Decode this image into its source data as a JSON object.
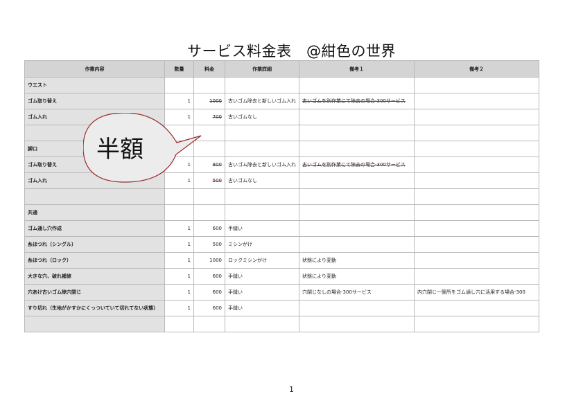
{
  "title": "サービス料金表　@紺色の世界",
  "columns": [
    "作業内容",
    "数量",
    "料金",
    "作業詳細",
    "備考１",
    "備考２"
  ],
  "rows": [
    [
      "ウエスト",
      "",
      "",
      "",
      "",
      ""
    ],
    [
      "ゴム取り替え",
      "1",
      "1000",
      "古いゴム除去と新しいゴム入れ",
      "古いゴムを別作業にて除去の場合-300サービス",
      ""
    ],
    [
      "ゴム入れ",
      "1",
      "700",
      "古いゴムなし",
      "",
      ""
    ],
    [
      "",
      "",
      "",
      "",
      "",
      ""
    ],
    [
      "脚口",
      "",
      "",
      "",
      "",
      ""
    ],
    [
      "ゴム取り替え",
      "1",
      "800",
      "古いゴム除去と新しいゴム入れ",
      "古いゴムを別作業にて除去の場合-300サービス",
      ""
    ],
    [
      "ゴム入れ",
      "1",
      "500",
      "古いゴムなし",
      "",
      ""
    ],
    [
      "",
      "",
      "",
      "",
      "",
      ""
    ],
    [
      "共通",
      "",
      "",
      "",
      "",
      ""
    ],
    [
      "ゴム通し穴作成",
      "1",
      "600",
      "手縫い",
      "",
      ""
    ],
    [
      "糸ほつれ（シングル）",
      "1",
      "500",
      "ミシンがけ",
      "",
      ""
    ],
    [
      "糸ほつれ（ロック）",
      "1",
      "1000",
      "ロックミシンがけ",
      "状態により変動",
      ""
    ],
    [
      "大きな穴、破れ補修",
      "1",
      "600",
      "手縫い",
      "状態により変動",
      ""
    ],
    [
      "穴あけ古いゴム除穴閉じ",
      "1",
      "600",
      "手縫い",
      "穴閉じなしの場合-300サービス",
      "内穴閉じ一箇所をゴム通し穴に活用する場合-300"
    ],
    [
      "すり切れ（生地がかすかにくっついていて切れてない状態）",
      "1",
      "600",
      "手縫い",
      "",
      ""
    ],
    [
      "",
      "",
      "",
      "",
      "",
      ""
    ]
  ],
  "struck_rows": [
    1,
    2,
    5,
    6
  ],
  "bubble": {
    "text": "半額"
  },
  "page_number": "1"
}
